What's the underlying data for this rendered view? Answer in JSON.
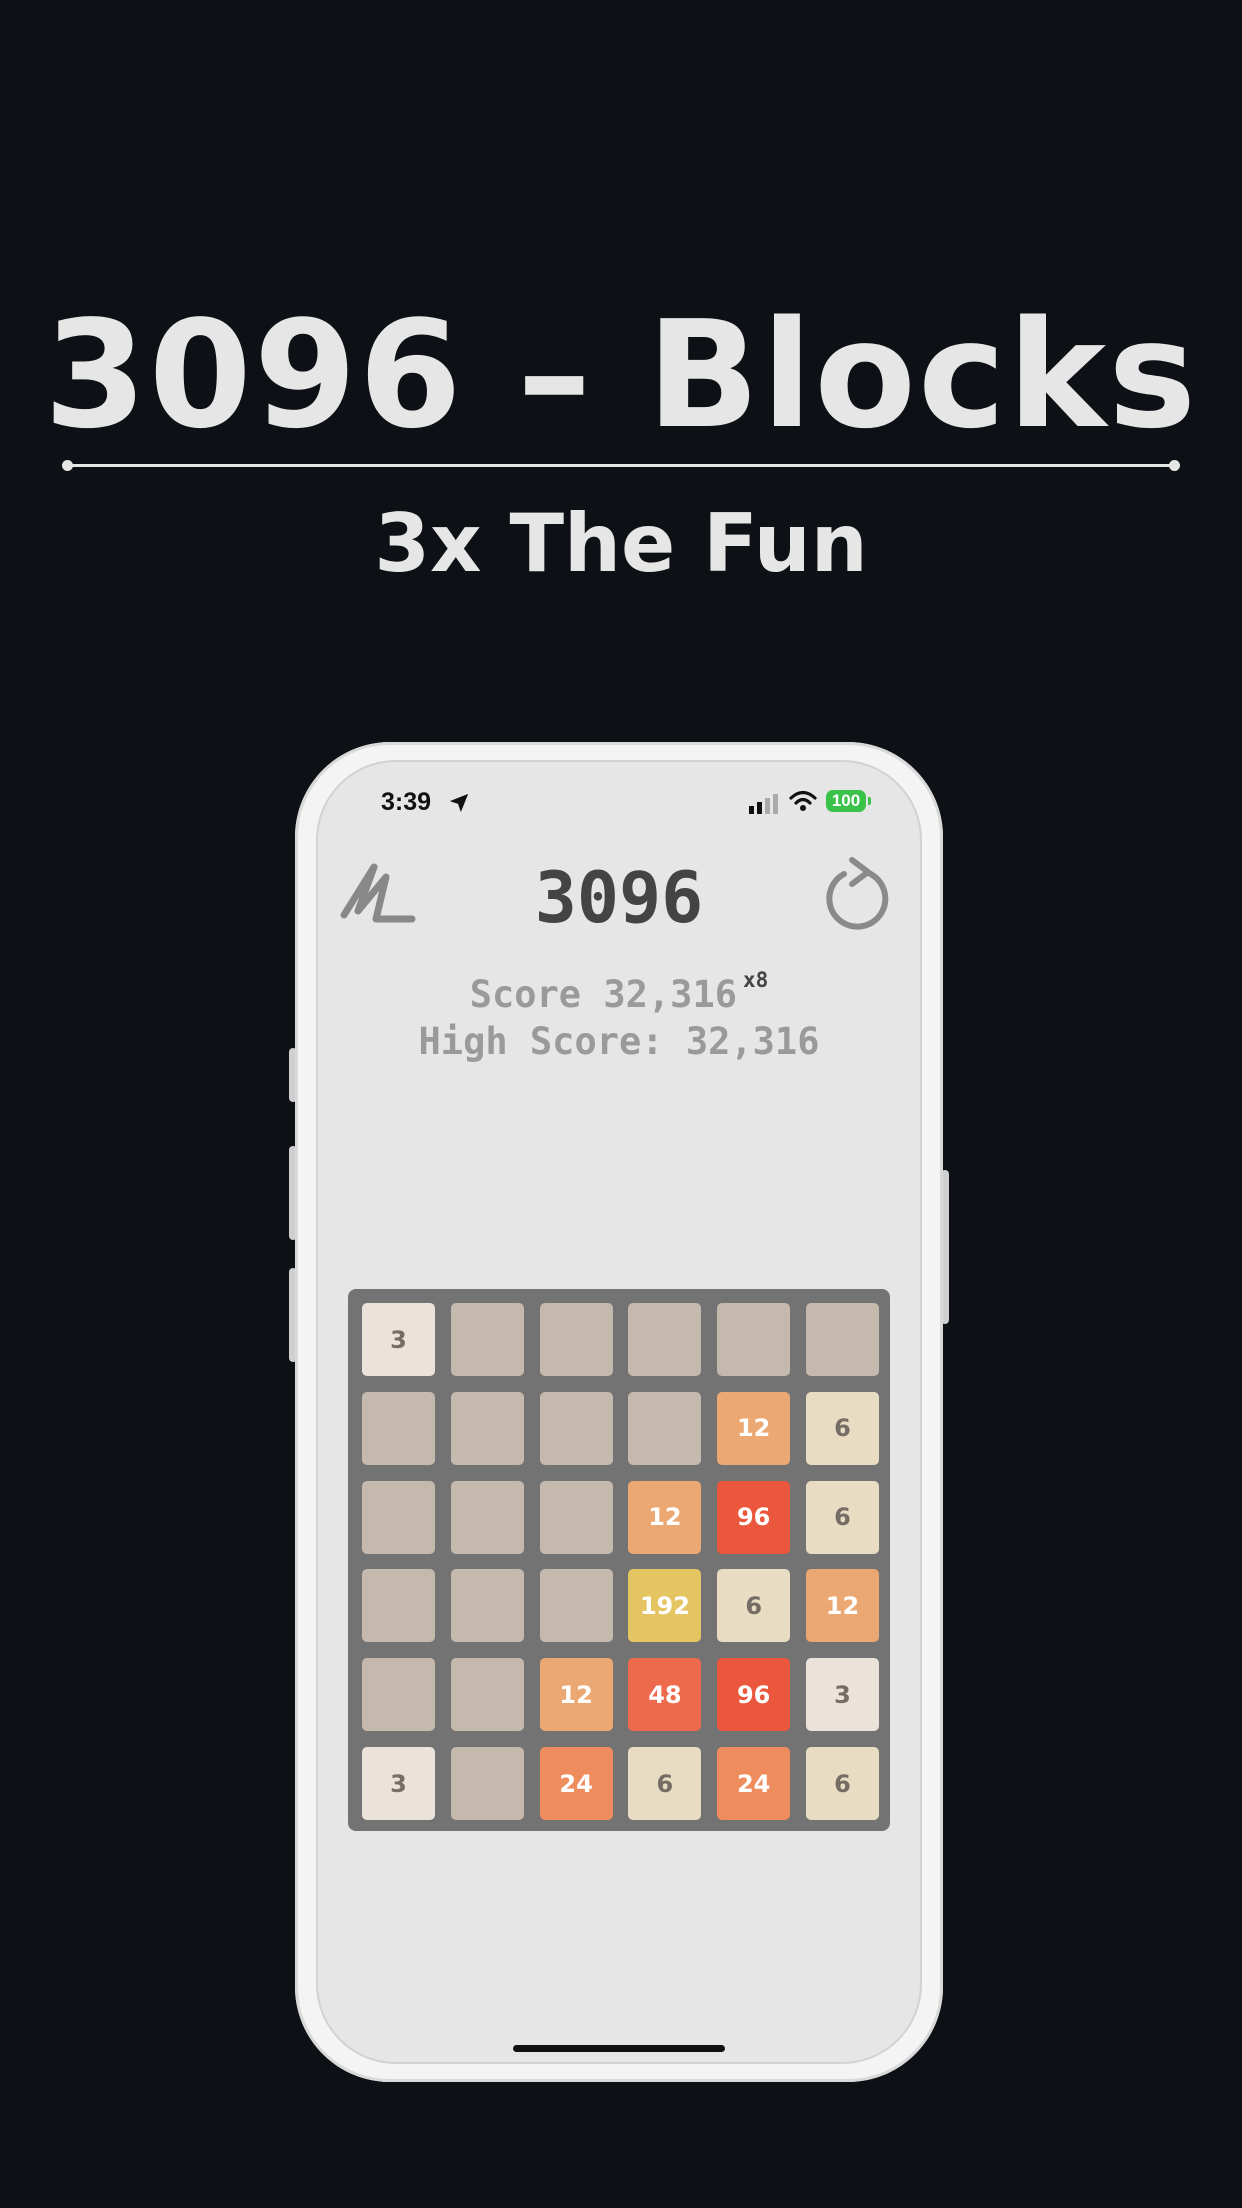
{
  "promo": {
    "headline": "3096 – Blocks",
    "subline": "3x The Fun"
  },
  "status_bar": {
    "time": "3:39",
    "battery": "100",
    "icons": [
      "location-arrow-icon",
      "signal-icon",
      "wifi-icon",
      "battery-icon"
    ]
  },
  "app": {
    "title": "3096",
    "left_icon": "scribble-icon",
    "right_icon": "restart-icon",
    "score_label": "Score 32,316",
    "multiplier": "x8",
    "high_score_label": "High Score: 32,316"
  },
  "board": {
    "rows": [
      [
        "3",
        "",
        "",
        "",
        "",
        ""
      ],
      [
        "",
        "",
        "",
        "",
        "12",
        "6"
      ],
      [
        "",
        "",
        "",
        "12",
        "96",
        "6"
      ],
      [
        "",
        "",
        "",
        "192",
        "6",
        "12"
      ],
      [
        "",
        "",
        "12",
        "48",
        "96",
        "3"
      ],
      [
        "3",
        "",
        "24",
        "6",
        "24",
        "6"
      ]
    ],
    "tile_colors": {
      "empty": {
        "bg": "#c5b9ad",
        "fg": "#c5b9ad"
      },
      "3": {
        "bg": "#ebe3da",
        "fg": "#766e65"
      },
      "6": {
        "bg": "#e8dcc3",
        "fg": "#766e65"
      },
      "12": {
        "bg": "#eca872",
        "fg": "#ffffff"
      },
      "24": {
        "bg": "#ee8c5e",
        "fg": "#ffffff"
      },
      "48": {
        "bg": "#ee6a4c",
        "fg": "#ffffff"
      },
      "96": {
        "bg": "#ea573c",
        "fg": "#ffffff"
      },
      "192": {
        "bg": "#e4c562",
        "fg": "#ffffff"
      }
    }
  }
}
